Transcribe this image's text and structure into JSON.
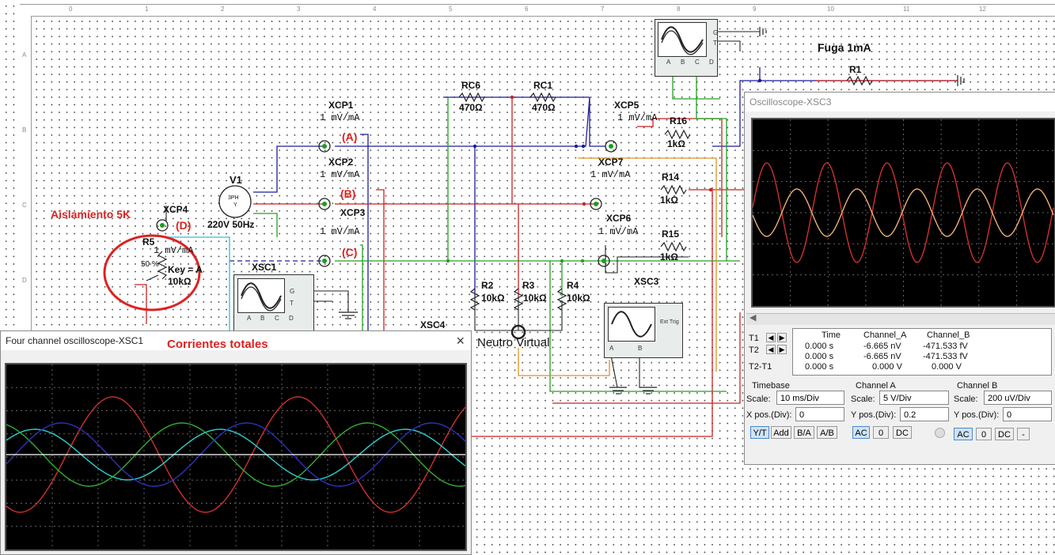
{
  "schematic": {
    "ruler_cols": [
      "0",
      "1",
      "2",
      "3",
      "4",
      "5",
      "6",
      "7",
      "8",
      "9",
      "10",
      "11",
      "12"
    ],
    "ruler_rows": [
      "A",
      "B",
      "C",
      "D",
      "E",
      "F",
      "G",
      "H"
    ],
    "probes": [
      {
        "name": "XCP1",
        "range": "1 mV/mA",
        "mark": "(A)"
      },
      {
        "name": "XCP2",
        "range": "1 mV/mA",
        "mark": "(B)"
      },
      {
        "name": "XCP3",
        "range": "1 mV/mA",
        "mark": "(C)"
      },
      {
        "name": "XCP4",
        "range": "1 mV/mA",
        "mark": "(D)"
      },
      {
        "name": "XCP5",
        "range": "1 mV/mA"
      },
      {
        "name": "XCP6",
        "range": "1 mV/mA"
      },
      {
        "name": "XCP7",
        "range": "1 mV/mA"
      }
    ],
    "source": {
      "name": "V1",
      "rating": "220V 50Hz",
      "symbol_top": "3PH",
      "symbol_bottom": "Y"
    },
    "resistors": {
      "RC6": {
        "name": "RC6",
        "value": "470Ω"
      },
      "RC1": {
        "name": "RC1",
        "value": "470Ω"
      },
      "R16": {
        "name": "R16",
        "value": "1kΩ"
      },
      "R14": {
        "name": "R14",
        "value": "1kΩ"
      },
      "R15": {
        "name": "R15",
        "value": "1kΩ"
      },
      "R2": {
        "name": "R2",
        "value": "10kΩ"
      },
      "R3": {
        "name": "R3",
        "value": "10kΩ"
      },
      "R4": {
        "name": "R4",
        "value": "10kΩ"
      },
      "R1": {
        "name": "R1"
      }
    },
    "pot": {
      "name": "R5",
      "percent": "50 %",
      "key": "Key = A",
      "value": "10kΩ"
    },
    "annotations": {
      "isolation": "Aislamiento 5K",
      "leak": "Fuga 1mA",
      "neutral": "Neutro Virtual",
      "totals": "Corrientes totales"
    },
    "instruments": {
      "xsc1": "XSC1",
      "xsc3": "XSC3",
      "xsc4": "XSC4"
    },
    "terminals": {
      "g": "G",
      "t": "T",
      "a": "A",
      "b": "B",
      "c": "C",
      "d": "D",
      "ext": "Ext Trig"
    }
  },
  "xsc3_window": {
    "title": "Oscilloscope-XSC3",
    "table_headers": [
      "Time",
      "Channel_A",
      "Channel_B"
    ],
    "rows": [
      {
        "label": "T1",
        "time": "0.000 s",
        "a": "-6.665 nV",
        "b": "-471.533 fV"
      },
      {
        "label": "T2",
        "time": "0.000 s",
        "a": "-6.665 nV",
        "b": "-471.533 fV"
      },
      {
        "label": "T2-T1",
        "time": "0.000 s",
        "a": "0.000 V",
        "b": "0.000 V"
      }
    ],
    "timebase": {
      "title": "Timebase",
      "scale_label": "Scale:",
      "scale": "10 ms/Div",
      "xpos_label": "X pos.(Div):",
      "xpos": "0",
      "modes": [
        "Y/T",
        "Add",
        "B/A",
        "A/B"
      ]
    },
    "channel_a": {
      "title": "Channel A",
      "scale_label": "Scale:",
      "scale": "5  V/Div",
      "ypos_label": "Y pos.(Div):",
      "ypos": "0.2",
      "coupling": [
        "AC",
        "0",
        "DC"
      ]
    },
    "channel_b": {
      "title": "Channel B",
      "scale_label": "Scale:",
      "scale": "200 uV/Div",
      "ypos_label": "Y pos.(Div):",
      "ypos": "0",
      "coupling": [
        "AC",
        "0",
        "DC",
        "-"
      ]
    },
    "colors": {
      "channel_a": "#d03030",
      "channel_b": "#f0b070"
    }
  },
  "xsc1_window": {
    "title": "Four channel oscilloscope-XSC1",
    "close": "×",
    "colors": {
      "a": "#d03030",
      "b": "#2ed0d0",
      "c": "#30b030",
      "d": "#3030c0"
    }
  }
}
